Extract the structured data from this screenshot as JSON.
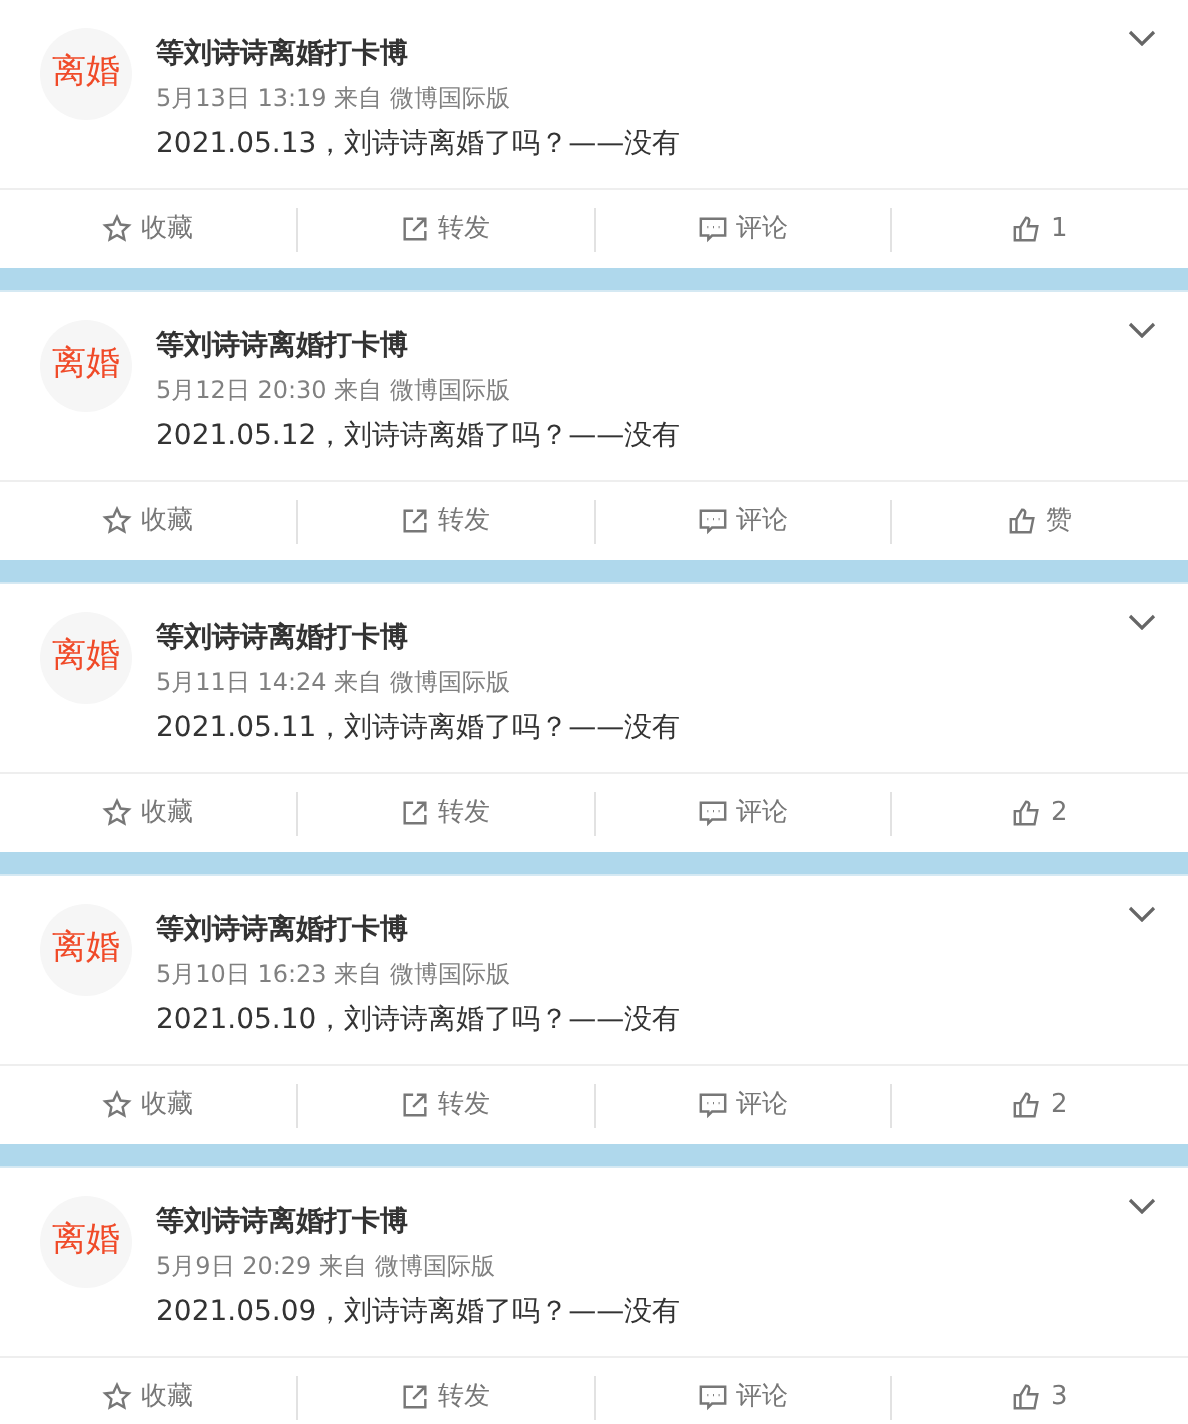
{
  "posts": [
    {
      "avatar_text": "离婚",
      "author": "等刘诗诗离婚打卡博",
      "meta": "5月13日 13:19 来自 微博国际版",
      "text": "2021.05.13，刘诗诗离婚了吗？——没有",
      "actions": [
        {
          "kind": "favorite",
          "label": "收藏"
        },
        {
          "kind": "repost",
          "label": "转发"
        },
        {
          "kind": "comment",
          "label": "评论"
        },
        {
          "kind": "like",
          "label": "1"
        }
      ]
    },
    {
      "avatar_text": "离婚",
      "author": "等刘诗诗离婚打卡博",
      "meta": "5月12日 20:30 来自 微博国际版",
      "text": "2021.05.12，刘诗诗离婚了吗？——没有",
      "actions": [
        {
          "kind": "favorite",
          "label": "收藏"
        },
        {
          "kind": "repost",
          "label": "转发"
        },
        {
          "kind": "comment",
          "label": "评论"
        },
        {
          "kind": "like",
          "label": "赞"
        }
      ]
    },
    {
      "avatar_text": "离婚",
      "author": "等刘诗诗离婚打卡博",
      "meta": "5月11日 14:24 来自 微博国际版",
      "text": "2021.05.11，刘诗诗离婚了吗？——没有",
      "actions": [
        {
          "kind": "favorite",
          "label": "收藏"
        },
        {
          "kind": "repost",
          "label": "转发"
        },
        {
          "kind": "comment",
          "label": "评论"
        },
        {
          "kind": "like",
          "label": "2"
        }
      ]
    },
    {
      "avatar_text": "离婚",
      "author": "等刘诗诗离婚打卡博",
      "meta": "5月10日 16:23 来自 微博国际版",
      "text": "2021.05.10，刘诗诗离婚了吗？——没有",
      "actions": [
        {
          "kind": "favorite",
          "label": "收藏"
        },
        {
          "kind": "repost",
          "label": "转发"
        },
        {
          "kind": "comment",
          "label": "评论"
        },
        {
          "kind": "like",
          "label": "2"
        }
      ]
    },
    {
      "avatar_text": "离婚",
      "author": "等刘诗诗离婚打卡博",
      "meta": "5月9日 20:29 来自 微博国际版",
      "text": "2021.05.09，刘诗诗离婚了吗？——没有",
      "actions": [
        {
          "kind": "favorite",
          "label": "收藏"
        },
        {
          "kind": "repost",
          "label": "转发"
        },
        {
          "kind": "comment",
          "label": "评论"
        },
        {
          "kind": "like",
          "label": "3"
        }
      ]
    }
  ]
}
